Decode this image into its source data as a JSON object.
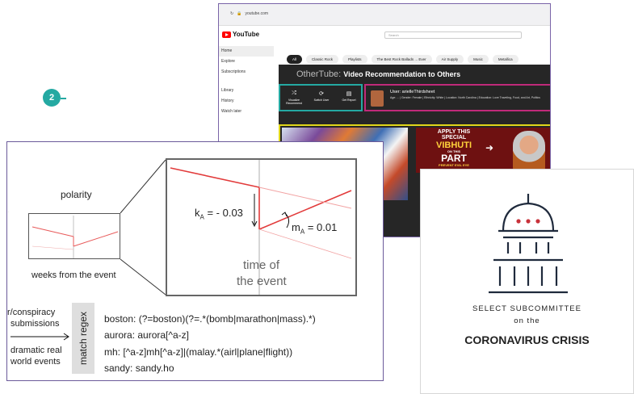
{
  "youtube": {
    "url": "youtube.com",
    "logo": "YouTube",
    "search_placeholder": "Search",
    "sidebar": [
      "Home",
      "Explore",
      "Subscriptions",
      "Library",
      "History",
      "Watch later"
    ],
    "chips": [
      "All",
      "Classic Rock",
      "Playlists",
      "The Best Rock Ballads ... Ever",
      "Air Supply",
      "Music",
      "Metallica"
    ],
    "othertube_title": "OtherTube:",
    "othertube_subtitle": "Video Recommendation to Others",
    "controls": [
      "Visualize Recommend",
      "Switch User",
      "Get Report"
    ],
    "badge": "2",
    "user_title": "User: arielleThirdsheet",
    "user_desc": "Age: ... | Gender: Female | Ethnicity: White | Location: North Carolina | Education: Love Traveling, Food, and Art, Politics",
    "thumb_line1": "APPLY THIS",
    "thumb_line2": "SPECIAL",
    "thumb_line3": "VIBHUTI",
    "thumb_line4": "ON THIS",
    "thumb_line5": "PART",
    "thumb_line6": "PREVENT EVIL EYE"
  },
  "chart_panel": {
    "polarity_label": "polarity",
    "weeks_label": "weeks from the event",
    "ka_label": "k",
    "ka_sub": "A",
    "ka_value": "= - 0.03",
    "ma_label": "m",
    "ma_sub": "A",
    "ma_value": "= 0.01",
    "time_label_1": "time of",
    "time_label_2": "the event",
    "left_label_1": "r/conspiracy",
    "left_label_2": "submissions",
    "left_label_3": "dramatic real",
    "left_label_4": "world events",
    "band_label": "match regex",
    "regex": [
      "boston: (?=boston)(?=.*(bomb|marathon|mass).*)",
      "aurora: aurora[^a-z]",
      "mh: [^a-z]mh[^a-z]|(malay.*(airl|plane|flight))",
      "sandy: sandy.ho"
    ]
  },
  "chart_data": {
    "type": "line",
    "title": "",
    "xlabel": "weeks from the event",
    "ylabel": "polarity",
    "series": [],
    "annotations": [
      "k_A = -0.03",
      "m_A = 0.01",
      "time of the event"
    ]
  },
  "seal": {
    "line1": "SELECT SUBCOMMITTEE",
    "line2": "on the",
    "line3": "CORONAVIRUS CRISIS",
    "star_color": "#c8313a",
    "ink_color": "#1f2a3c"
  }
}
